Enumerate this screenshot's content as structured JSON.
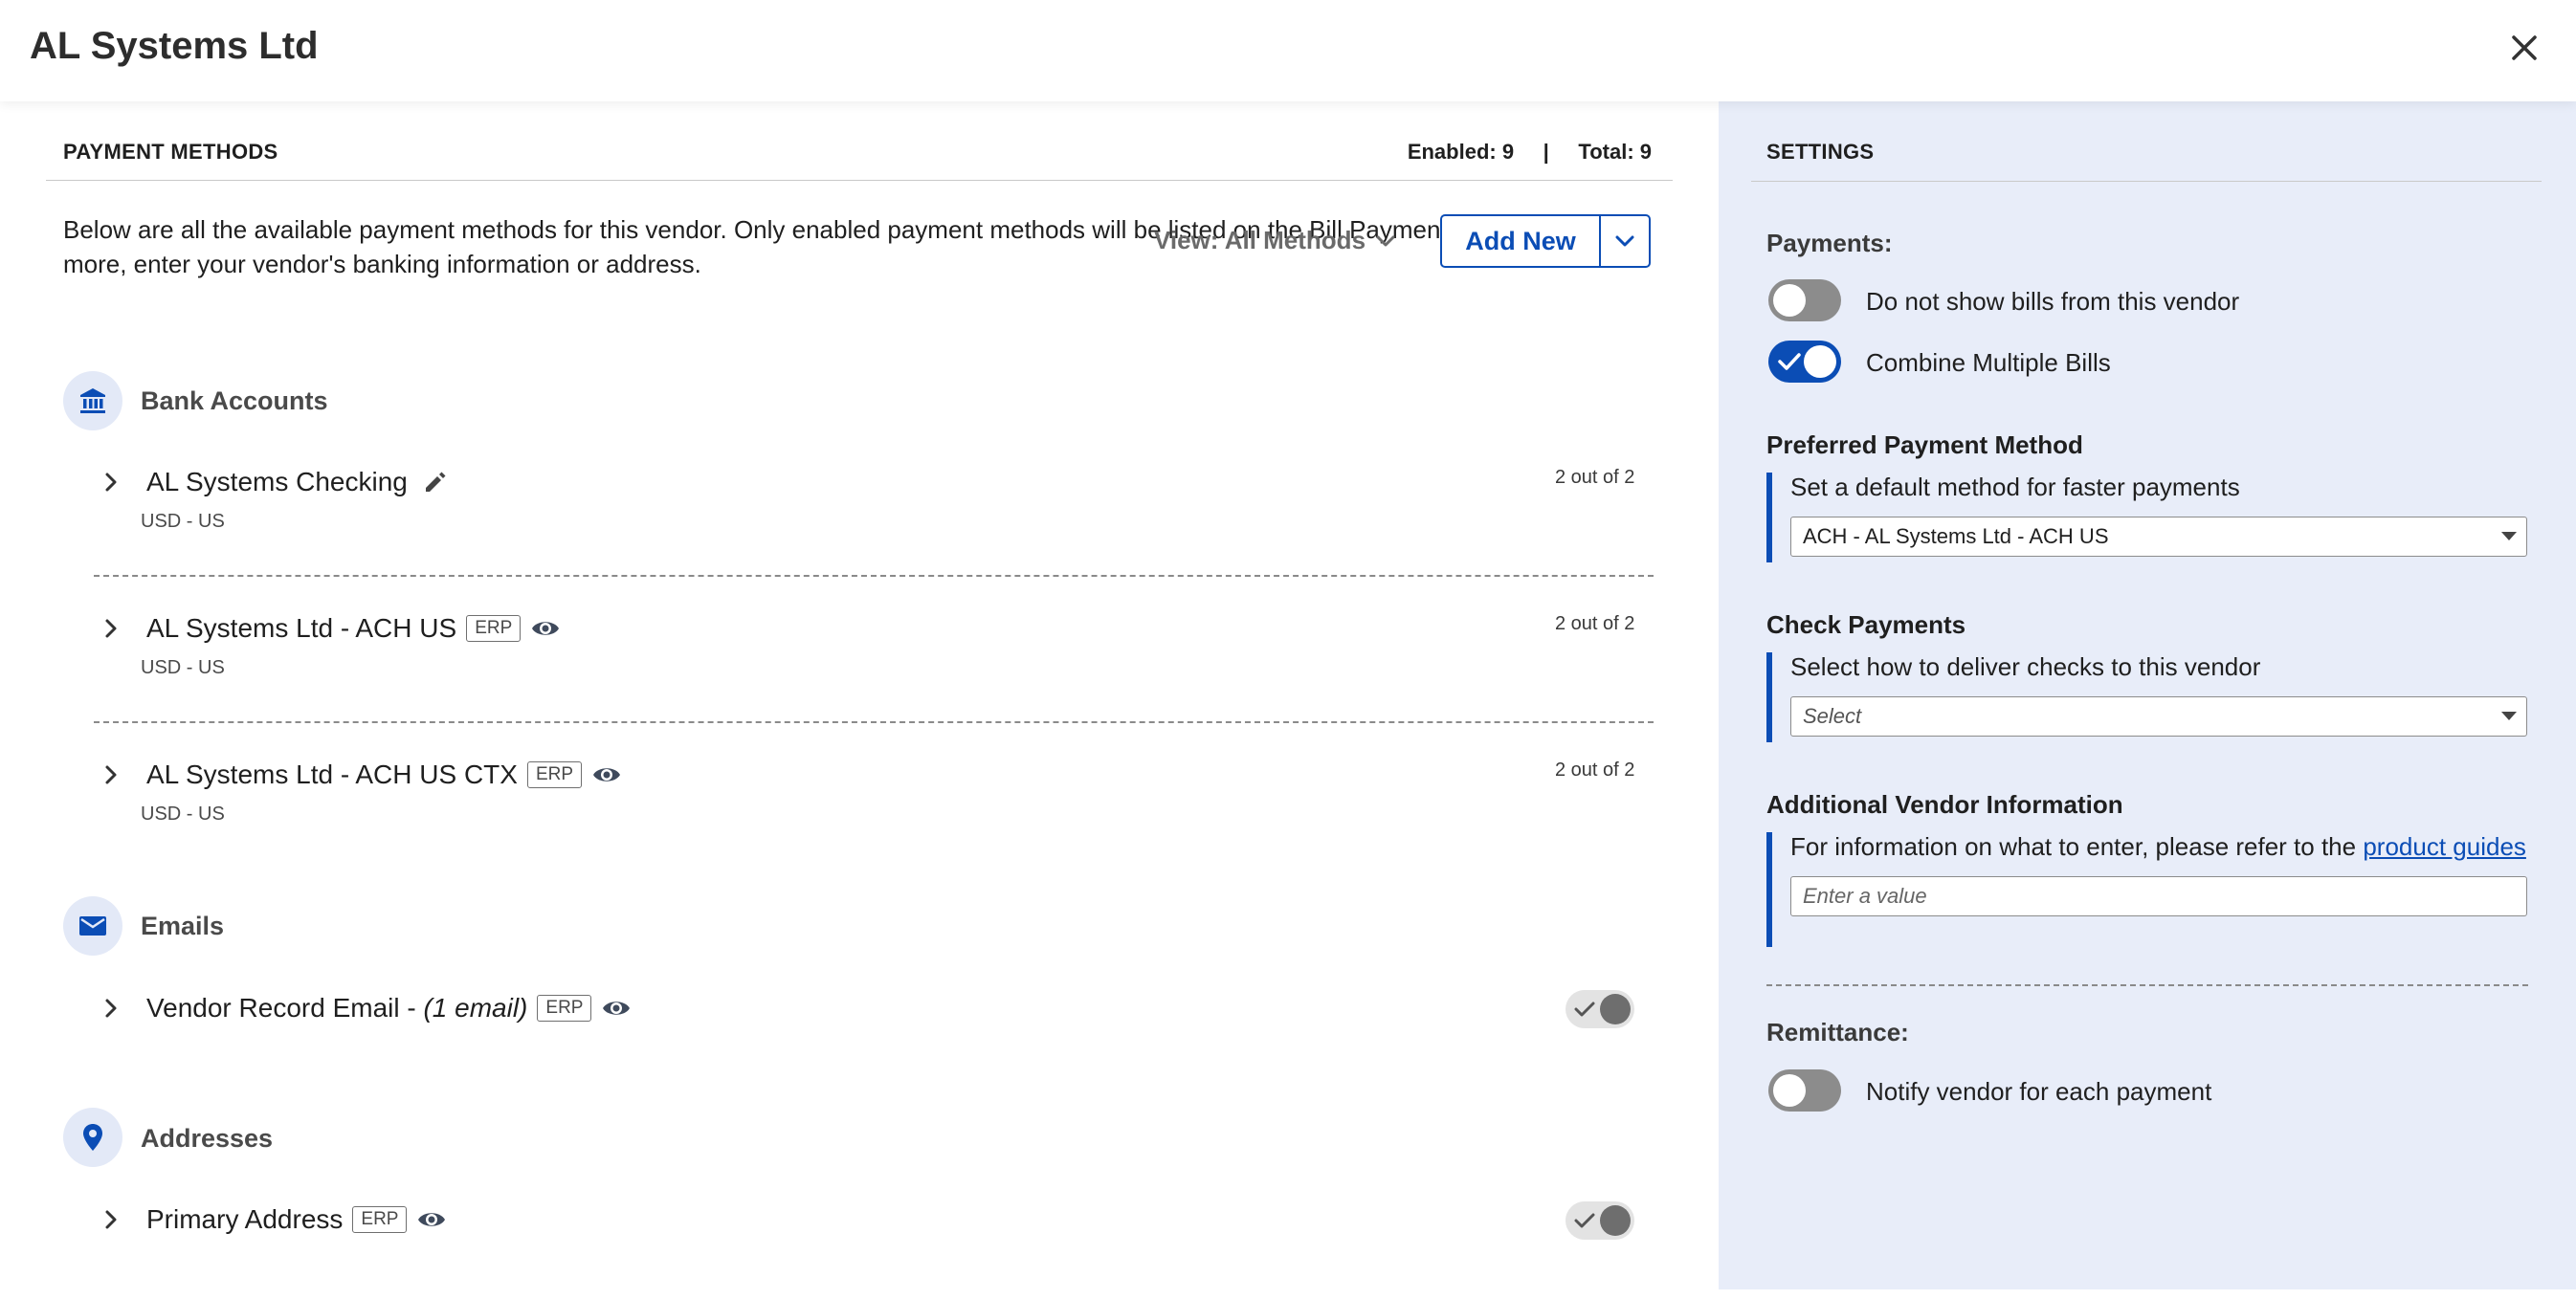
{
  "header": {
    "title": "AL Systems Ltd"
  },
  "payment_methods": {
    "section_title": "PAYMENT METHODS",
    "enabled_label": "Enabled: 9",
    "separator": "|",
    "total_label": "Total: 9",
    "description": "Below are all the available payment methods for this vendor. Only enabled payment methods will be listed on the Bill Payments page. To add more, enter your vendor's banking information or address.",
    "view_label": "View: All Methods",
    "add_new_label": "Add New",
    "groups": {
      "bank": {
        "title": "Bank Accounts",
        "items": [
          {
            "name": "AL Systems Checking",
            "sub": "USD - US",
            "count": "2 out of 2"
          },
          {
            "name": "AL Systems Ltd - ACH US",
            "badge": "ERP",
            "sub": "USD - US",
            "count": "2 out of 2"
          },
          {
            "name": "AL Systems Ltd - ACH US CTX",
            "badge": "ERP",
            "sub": "USD - US",
            "count": "2 out of 2"
          }
        ]
      },
      "emails": {
        "title": "Emails",
        "items": [
          {
            "name": "Vendor Record Email - ",
            "name_italic": "(1 email)",
            "badge": "ERP"
          }
        ]
      },
      "addresses": {
        "title": "Addresses",
        "items": [
          {
            "name": "Primary Address",
            "badge": "ERP"
          }
        ]
      }
    }
  },
  "settings": {
    "section_title": "SETTINGS",
    "payments_label": "Payments:",
    "toggles": {
      "hide_bills": {
        "label": "Do not show bills from this vendor",
        "on": false
      },
      "combine": {
        "label": "Combine Multiple Bills",
        "on": true
      },
      "notify": {
        "label": "Notify vendor for each payment",
        "on": false
      }
    },
    "preferred": {
      "title": "Preferred Payment Method",
      "help": "Set a default method for faster payments",
      "value": "ACH - AL Systems Ltd - ACH US"
    },
    "check": {
      "title": "Check Payments",
      "help": "Select how to deliver checks to this vendor",
      "placeholder": "Select"
    },
    "additional": {
      "title": "Additional Vendor Information",
      "help": "For information on what to enter, please refer to the ",
      "link": "product guides",
      "placeholder": "Enter a value"
    },
    "remittance_label": "Remittance:"
  },
  "colors": {
    "accent": "#0b4db5",
    "settings_bg": "#e8edf9"
  },
  "icons": [
    "close-icon",
    "bank-icon",
    "pencil-icon",
    "eye-icon",
    "chevron-right-icon",
    "chevron-down-icon",
    "mail-icon",
    "location-pin-icon",
    "check-icon"
  ]
}
